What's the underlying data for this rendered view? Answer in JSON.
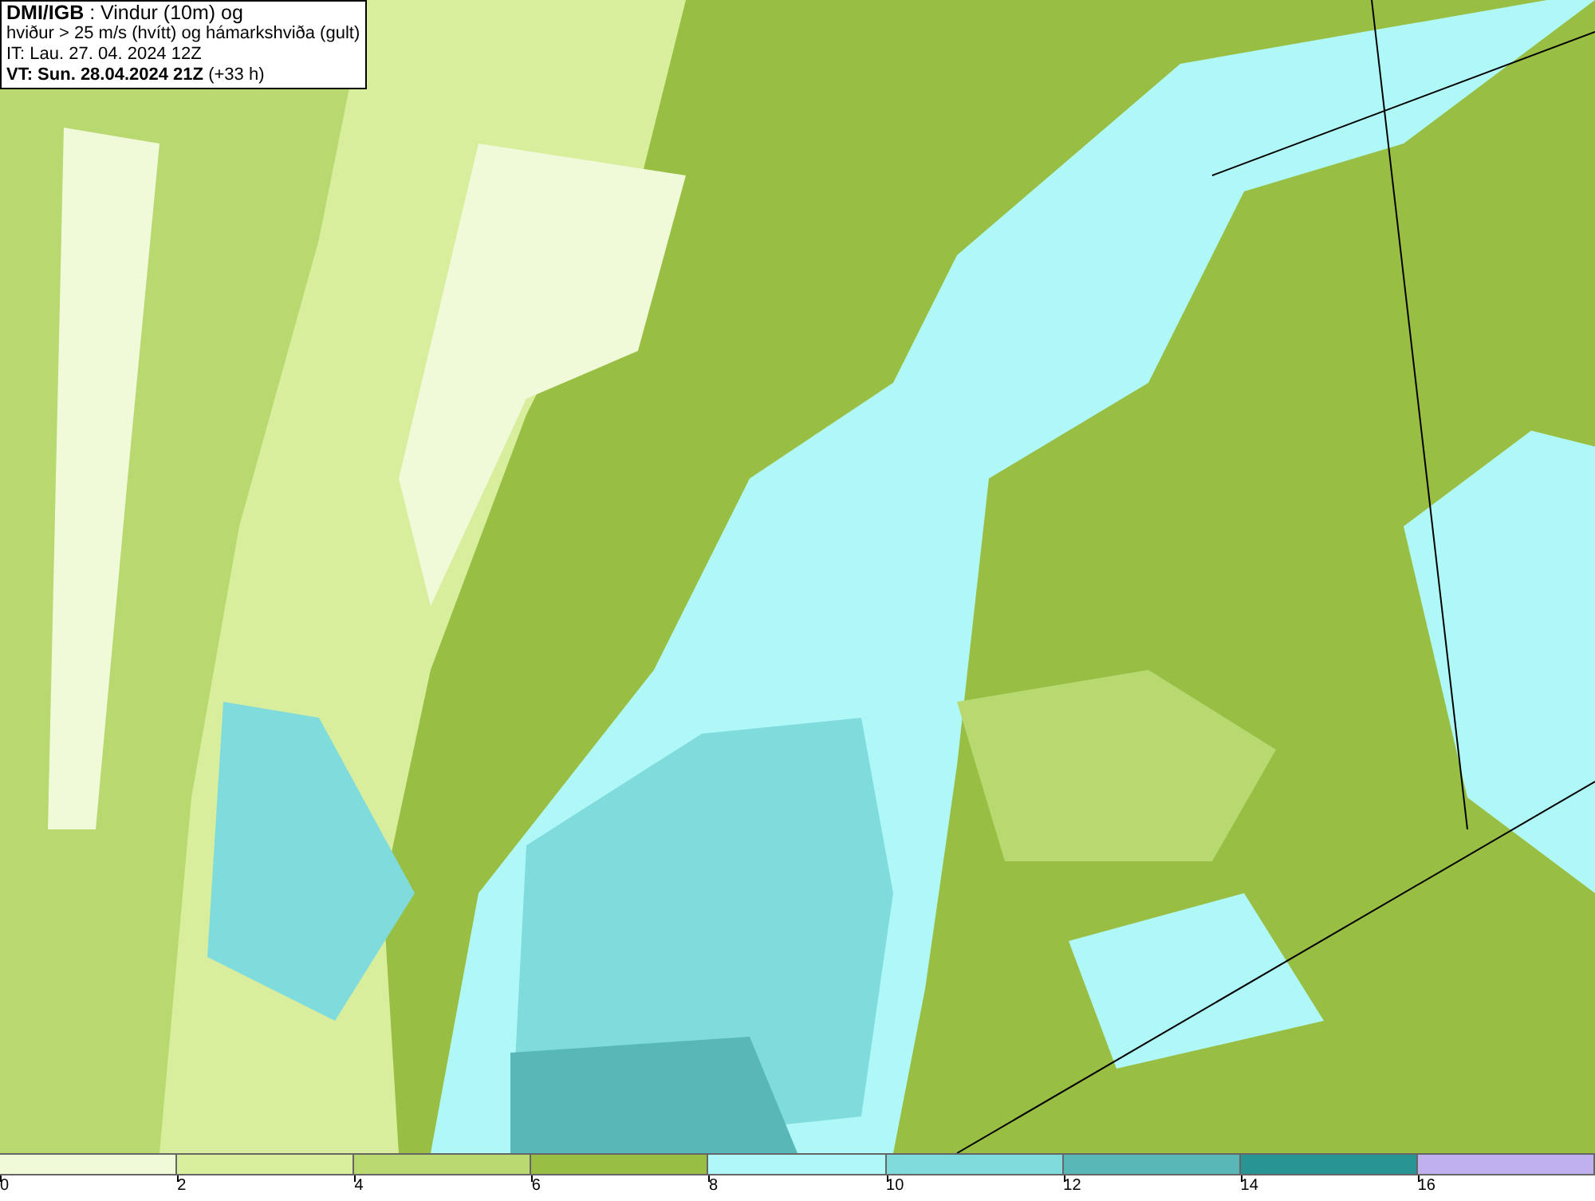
{
  "header": {
    "lines": [
      "**DMI/IGB** : Vindur (10m) og",
      "hviður > 25 m/s (hvítt) og hámarkshviða (gult)",
      "IT: Lau. 27. 04. 2024 12Z",
      "**VT: Sun. 28.04.2024 21Z** (+33 h)"
    ]
  },
  "legend": [
    {
      "label": "0",
      "color": "#f0f9d8"
    },
    {
      "label": "2",
      "color": "#d8ee9c"
    },
    {
      "label": "4",
      "color": "#b8d870"
    },
    {
      "label": "6",
      "color": "#98bf44"
    },
    {
      "label": "8",
      "color": "#b0f8f8"
    },
    {
      "label": "10",
      "color": "#80dcdc"
    },
    {
      "label": "12",
      "color": "#58b8b8"
    },
    {
      "label": "14",
      "color": "#289494"
    },
    {
      "label": "16",
      "color": "#c0b0f0"
    }
  ]
}
